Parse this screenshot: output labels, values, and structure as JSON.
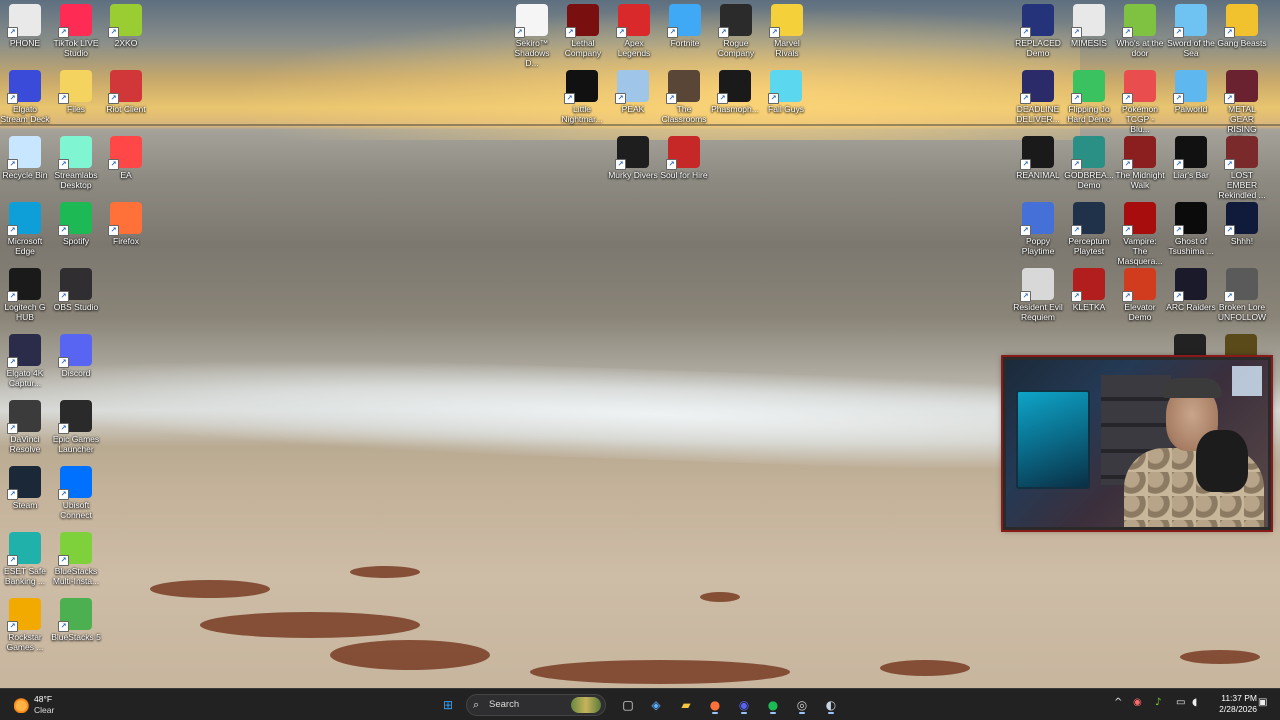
{
  "desktop": {
    "left_column_1": [
      {
        "label": "PHONE",
        "icon": "phone-folder-icon",
        "color": "#e9e9e9"
      },
      {
        "label": "Elgato Stream Deck",
        "icon": "stream-deck-icon",
        "color": "#3a4ad9"
      },
      {
        "label": "Recycle Bin",
        "icon": "recycle-bin-icon",
        "color": "#c8e6ff"
      },
      {
        "label": "Microsoft Edge",
        "icon": "edge-icon",
        "color": "#0f9fd8"
      },
      {
        "label": "Logitech G HUB",
        "icon": "logitech-ghub-icon",
        "color": "#1a1a1a"
      },
      {
        "label": "Elgato 4K Captur...",
        "icon": "elgato-4k-icon",
        "color": "#2b2b4a"
      },
      {
        "label": "DaVinci Resolve",
        "icon": "davinci-resolve-icon",
        "color": "#3b3b3b"
      },
      {
        "label": "Steam",
        "icon": "steam-icon",
        "color": "#1b2838"
      },
      {
        "label": "ESET Safe Banking ...",
        "icon": "eset-icon",
        "color": "#20b2aa"
      },
      {
        "label": "Rockstar Games ...",
        "icon": "rockstar-icon",
        "color": "#f2a900"
      }
    ],
    "left_column_2": [
      {
        "label": "TikTok LIVE Studio",
        "icon": "tiktok-live-icon",
        "color": "#fe2c55"
      },
      {
        "label": "Files",
        "icon": "folder-icon",
        "color": "#f4d35e"
      },
      {
        "label": "Streamlabs Desktop",
        "icon": "streamlabs-icon",
        "color": "#80f5d2"
      },
      {
        "label": "Spotify",
        "icon": "spotify-icon",
        "color": "#1db954"
      },
      {
        "label": "OBS Studio",
        "icon": "obs-icon",
        "color": "#302e31"
      },
      {
        "label": "Discord",
        "icon": "discord-icon",
        "color": "#5865f2"
      },
      {
        "label": "Epic Games Launcher",
        "icon": "epic-games-icon",
        "color": "#2a2a2a"
      },
      {
        "label": "Ubisoft Connect",
        "icon": "ubisoft-icon",
        "color": "#0070ff"
      },
      {
        "label": "BlueStacks Multi-Insta...",
        "icon": "bluestacks-multi-icon",
        "color": "#7fd13b"
      },
      {
        "label": "BlueStacks 5",
        "icon": "bluestacks-icon",
        "color": "#4caf50"
      }
    ],
    "left_column_3": [
      {
        "label": "2XKO",
        "icon": "2xko-icon",
        "color": "#9acd32"
      },
      {
        "label": "Riot Client",
        "icon": "riot-client-icon",
        "color": "#d13639"
      },
      {
        "label": "EA",
        "icon": "ea-icon",
        "color": "#ff4747"
      },
      {
        "label": "Firefox",
        "icon": "firefox-icon",
        "color": "#ff7139"
      }
    ],
    "center_row_1": [
      {
        "label": "Sekiro™ Shadows D...",
        "icon": "sekiro-icon",
        "color": "#f5f5f5"
      },
      {
        "label": "Lethal Company",
        "icon": "lethal-company-icon",
        "color": "#7a0f0f"
      },
      {
        "label": "Apex Legends",
        "icon": "apex-legends-icon",
        "color": "#da292a"
      },
      {
        "label": "Fortnite",
        "icon": "fortnite-icon",
        "color": "#3fa9f5"
      },
      {
        "label": "Rogue Company",
        "icon": "rogue-company-icon",
        "color": "#2b2b2b"
      },
      {
        "label": "Marvel Rivals",
        "icon": "marvel-rivals-icon",
        "color": "#f4d13b"
      }
    ],
    "center_row_2": [
      {
        "label": "Little Nightmar...",
        "icon": "little-nightmares-icon",
        "color": "#111111"
      },
      {
        "label": "PEAK",
        "icon": "peak-icon",
        "color": "#9fc5e8"
      },
      {
        "label": "The Classrooms",
        "icon": "classrooms-icon",
        "color": "#5a4636"
      },
      {
        "label": "Phasmoph...",
        "icon": "phasmophobia-icon",
        "color": "#1a1a1a"
      },
      {
        "label": "Fall Guys",
        "icon": "fall-guys-icon",
        "color": "#5bd7f0"
      }
    ],
    "center_row_3": [
      {
        "label": "Murky Divers",
        "icon": "murky-divers-icon",
        "color": "#1e1e1e"
      },
      {
        "label": "Soul for Hire",
        "icon": "soul-for-hire-icon",
        "color": "#c62828"
      }
    ],
    "right_rows": [
      [
        {
          "label": "REPLACED Demo",
          "icon": "replaced-icon",
          "color": "#25347a"
        },
        {
          "label": "MIMESIS",
          "icon": "mimesis-icon",
          "color": "#e8e8e8"
        },
        {
          "label": "Who's at the door",
          "icon": "whos-at-door-icon",
          "color": "#7fc241"
        },
        {
          "label": "Sword of the Sea",
          "icon": "sword-of-sea-icon",
          "color": "#6ec3f2"
        },
        {
          "label": "Gang Beasts",
          "icon": "gang-beasts-icon",
          "color": "#f2c12e"
        }
      ],
      [
        {
          "label": "DEADLINE DELIVER...",
          "icon": "deadline-deliver-icon",
          "color": "#2b2b6a"
        },
        {
          "label": "Flipping Jo Hard Demo",
          "icon": "flipping-jo-icon",
          "color": "#39c25f"
        },
        {
          "label": "Pokémon TCGP - Blu...",
          "icon": "pokemon-tcgp-icon",
          "color": "#e94d4d"
        },
        {
          "label": "Palworld",
          "icon": "palworld-icon",
          "color": "#5fb7f0"
        },
        {
          "label": "METAL GEAR RISING REV...",
          "icon": "metal-gear-rising-icon",
          "color": "#6a2130"
        }
      ],
      [
        {
          "label": "REANIMAL",
          "icon": "reanimal-icon",
          "color": "#1a1a1a"
        },
        {
          "label": "GODBREA... Demo",
          "icon": "godbreakers-icon",
          "color": "#2a8f84"
        },
        {
          "label": "The Midnight Walk",
          "icon": "midnight-walk-icon",
          "color": "#8b1f1f"
        },
        {
          "label": "Liar's Bar",
          "icon": "liars-bar-icon",
          "color": "#111111"
        },
        {
          "label": "LOST EMBER Rekindled ...",
          "icon": "lost-ember-icon",
          "color": "#7a2a2a"
        }
      ],
      [
        {
          "label": "Poppy Playtime",
          "icon": "poppy-playtime-icon",
          "color": "#4470d8"
        },
        {
          "label": "Perceptum Playtest",
          "icon": "perceptum-icon",
          "color": "#20324a"
        },
        {
          "label": "Vampire: The Masquera...",
          "icon": "vampire-masquerade-icon",
          "color": "#a80d0d"
        },
        {
          "label": "Ghost of Tsushima ...",
          "icon": "ghost-of-tsushima-icon",
          "color": "#0b0b0b"
        },
        {
          "label": "Shhh!",
          "icon": "shhh-icon",
          "color": "#101a3a"
        }
      ],
      [
        {
          "label": "Resident Evil Requiem",
          "icon": "resident-evil-icon",
          "color": "#d8d8d8"
        },
        {
          "label": "KLETKA",
          "icon": "kletka-icon",
          "color": "#b21e1e"
        },
        {
          "label": "Elevator Demo",
          "icon": "elevator-demo-icon",
          "color": "#d23c1e"
        },
        {
          "label": "ARC Raiders",
          "icon": "arc-raiders-icon",
          "color": "#1a1a2a"
        },
        {
          "label": "Broken Lore UNFOLLOW",
          "icon": "broken-lore-icon",
          "color": "#5a5a5a"
        }
      ]
    ]
  },
  "taskbar": {
    "weather": {
      "temp": "48°F",
      "condition": "Clear"
    },
    "search_label": "Search",
    "apps": [
      {
        "name": "start-button",
        "icon": "windows-icon",
        "glyph": "⊞",
        "color": "#3c9be8"
      },
      {
        "name": "taskbar-task-view",
        "icon": "task-view-icon",
        "glyph": "▢",
        "color": "#e6e6e6"
      },
      {
        "name": "taskbar-copilot",
        "icon": "copilot-icon",
        "glyph": "◈",
        "color": "#5fb0ff"
      },
      {
        "name": "taskbar-file-explorer",
        "icon": "file-explorer-icon",
        "glyph": "▰",
        "color": "#f4c542"
      },
      {
        "name": "taskbar-firefox",
        "icon": "firefox-icon",
        "glyph": "●",
        "color": "#ff7139"
      },
      {
        "name": "taskbar-discord",
        "icon": "discord-icon",
        "glyph": "◉",
        "color": "#5865f2"
      },
      {
        "name": "taskbar-spotify",
        "icon": "spotify-icon",
        "glyph": "●",
        "color": "#1db954"
      },
      {
        "name": "taskbar-obs",
        "icon": "obs-icon",
        "glyph": "◎",
        "color": "#cfcfcf"
      },
      {
        "name": "taskbar-steam",
        "icon": "steam-icon",
        "glyph": "◐",
        "color": "#c7d5e0"
      }
    ],
    "tray": {
      "chevron": "^",
      "clock_time": "11:37 PM",
      "clock_date": "2/28/2026"
    }
  }
}
